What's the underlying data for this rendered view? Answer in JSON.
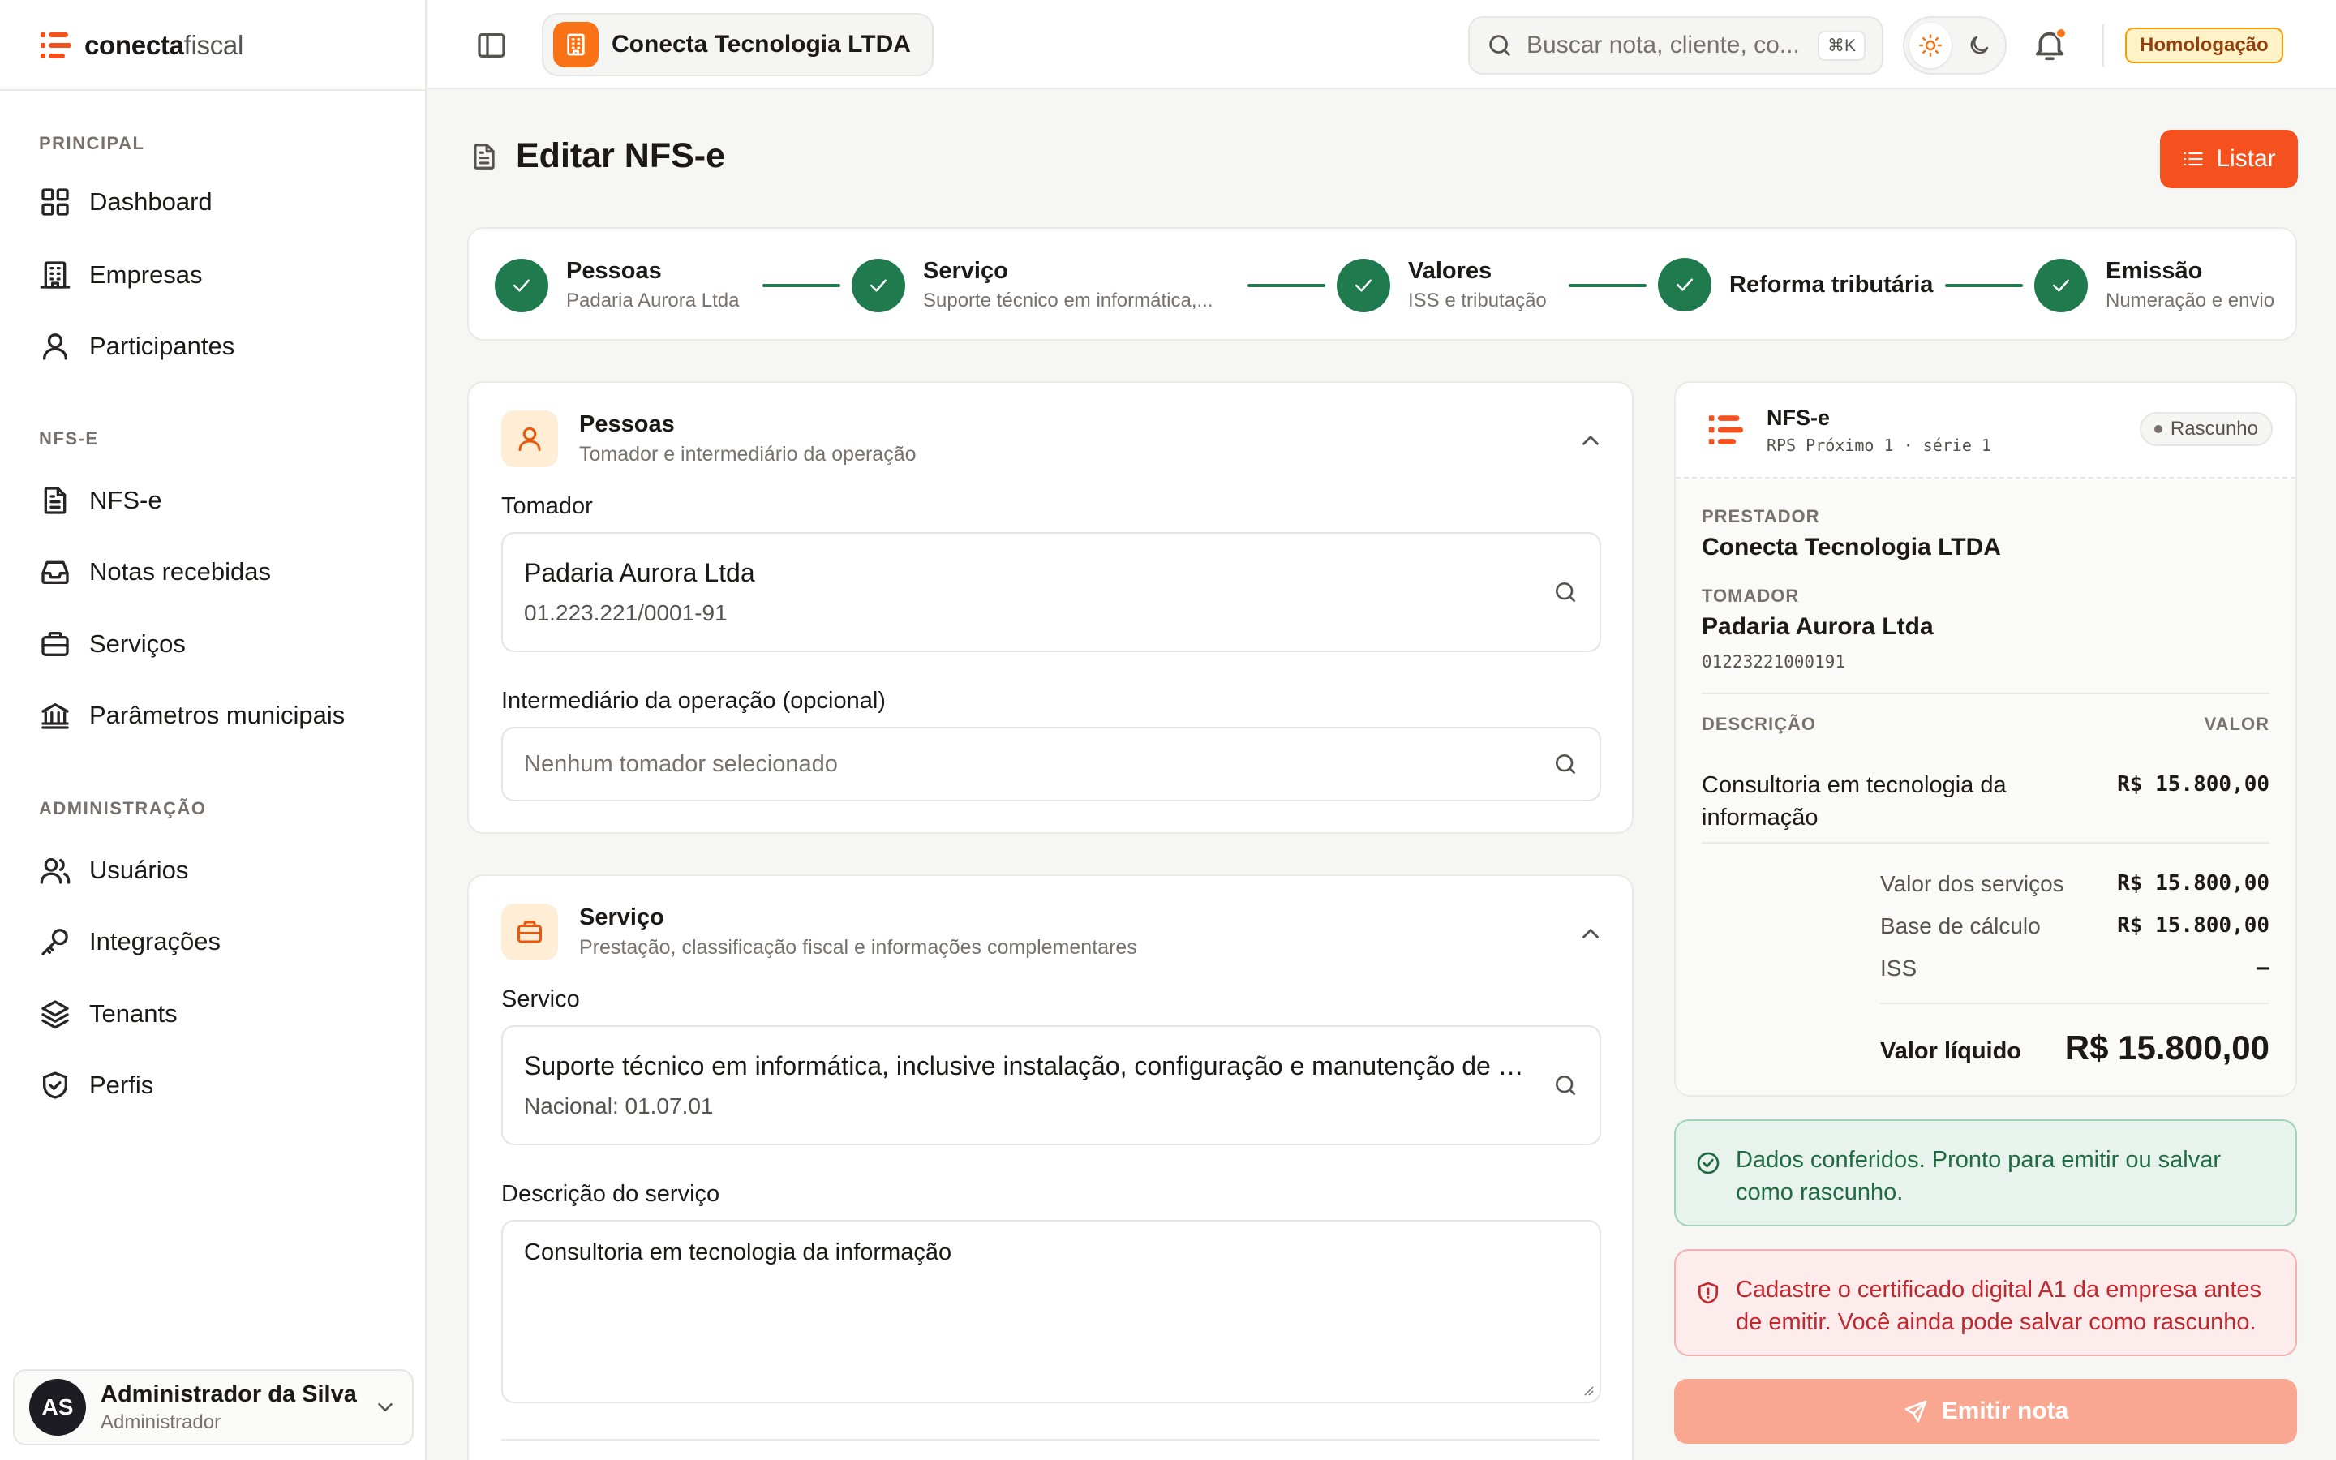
{
  "app": {
    "brand_bold": "conecta",
    "brand_light": "fiscal"
  },
  "sidebar": {
    "sections": [
      {
        "label": "PRINCIPAL",
        "items": [
          {
            "label": "Dashboard",
            "icon": "grid-icon"
          },
          {
            "label": "Empresas",
            "icon": "building-icon"
          },
          {
            "label": "Participantes",
            "icon": "user-icon"
          }
        ]
      },
      {
        "label": "NFS-E",
        "items": [
          {
            "label": "NFS-e",
            "icon": "document-icon"
          },
          {
            "label": "Notas recebidas",
            "icon": "inbox-icon"
          },
          {
            "label": "Serviços",
            "icon": "briefcase-icon"
          },
          {
            "label": "Parâmetros municipais",
            "icon": "bank-icon"
          }
        ]
      },
      {
        "label": "ADMINISTRAÇÃO",
        "items": [
          {
            "label": "Usuários",
            "icon": "users-icon"
          },
          {
            "label": "Integrações",
            "icon": "key-icon"
          },
          {
            "label": "Tenants",
            "icon": "layers-icon"
          },
          {
            "label": "Perfis",
            "icon": "shield-icon"
          }
        ]
      }
    ],
    "user": {
      "initials": "AS",
      "name": "Administrador da Silva",
      "role": "Administrador"
    }
  },
  "header": {
    "company": "Conecta Tecnologia LTDA",
    "search_placeholder": "Buscar nota, cliente, co...",
    "search_shortcut": "⌘K",
    "environment": "Homologação"
  },
  "page": {
    "title": "Editar NFS-e",
    "list_button": "Listar"
  },
  "stepper": [
    {
      "title": "Pessoas",
      "subtitle": "Padaria Aurora Ltda",
      "done": true
    },
    {
      "title": "Serviço",
      "subtitle": "Suporte técnico em informática,...",
      "done": true
    },
    {
      "title": "Valores",
      "subtitle": "ISS e tributação",
      "done": true
    },
    {
      "title": "Reforma tributária",
      "subtitle": "",
      "done": true
    },
    {
      "title": "Emissão",
      "subtitle": "Numeração e envio",
      "done": true
    }
  ],
  "pessoas": {
    "title": "Pessoas",
    "subtitle": "Tomador e intermediário da operação",
    "tomador_label": "Tomador",
    "tomador_name": "Padaria Aurora Ltda",
    "tomador_doc": "01.223.221/0001-91",
    "intermediario_label": "Intermediário da operação (opcional)",
    "intermediario_placeholder": "Nenhum tomador selecionado"
  },
  "servico": {
    "title": "Serviço",
    "subtitle": "Prestação, classificação fiscal e informações complementares",
    "servico_label": "Servico",
    "servico_value": "Suporte técnico em informática, inclusive instalação, configuração e manutenção de programas de computação e bancos de dados",
    "servico_code": "Nacional: 01.07.01",
    "descricao_label": "Descrição do serviço",
    "descricao_value": "Consultoria em tecnologia da informação"
  },
  "summary": {
    "title": "NFS-e",
    "rps": "RPS Próximo 1 · série 1",
    "status": "Rascunho",
    "prestador_label": "PRESTADOR",
    "prestador": "Conecta Tecnologia LTDA",
    "tomador_label": "TOMADOR",
    "tomador": "Padaria Aurora Ltda",
    "tomador_doc": "01223221000191",
    "desc_header": "DESCRIÇÃO",
    "valor_header": "VALOR",
    "item_desc": "Consultoria em tecnologia da informação",
    "item_valor": "R$ 15.800,00",
    "valor_servicos_label": "Valor dos serviços",
    "valor_servicos": "R$ 15.800,00",
    "base_label": "Base de cálculo",
    "base": "R$ 15.800,00",
    "iss_label": "ISS",
    "iss": "–",
    "liquido_label": "Valor líquido",
    "liquido": "R$ 15.800,00"
  },
  "alerts": {
    "ok": "Dados conferidos. Pronto para emitir ou salvar como rascunho.",
    "error": "Cadastre o certificado digital A1 da empresa antes de emitir. Você ainda pode salvar como rascunho."
  },
  "emit_button": "Emitir nota",
  "colors": {
    "accent": "#f4511e",
    "success": "#1f7a4e",
    "warning_bg": "#fef3c7",
    "error": "#c1272d"
  }
}
